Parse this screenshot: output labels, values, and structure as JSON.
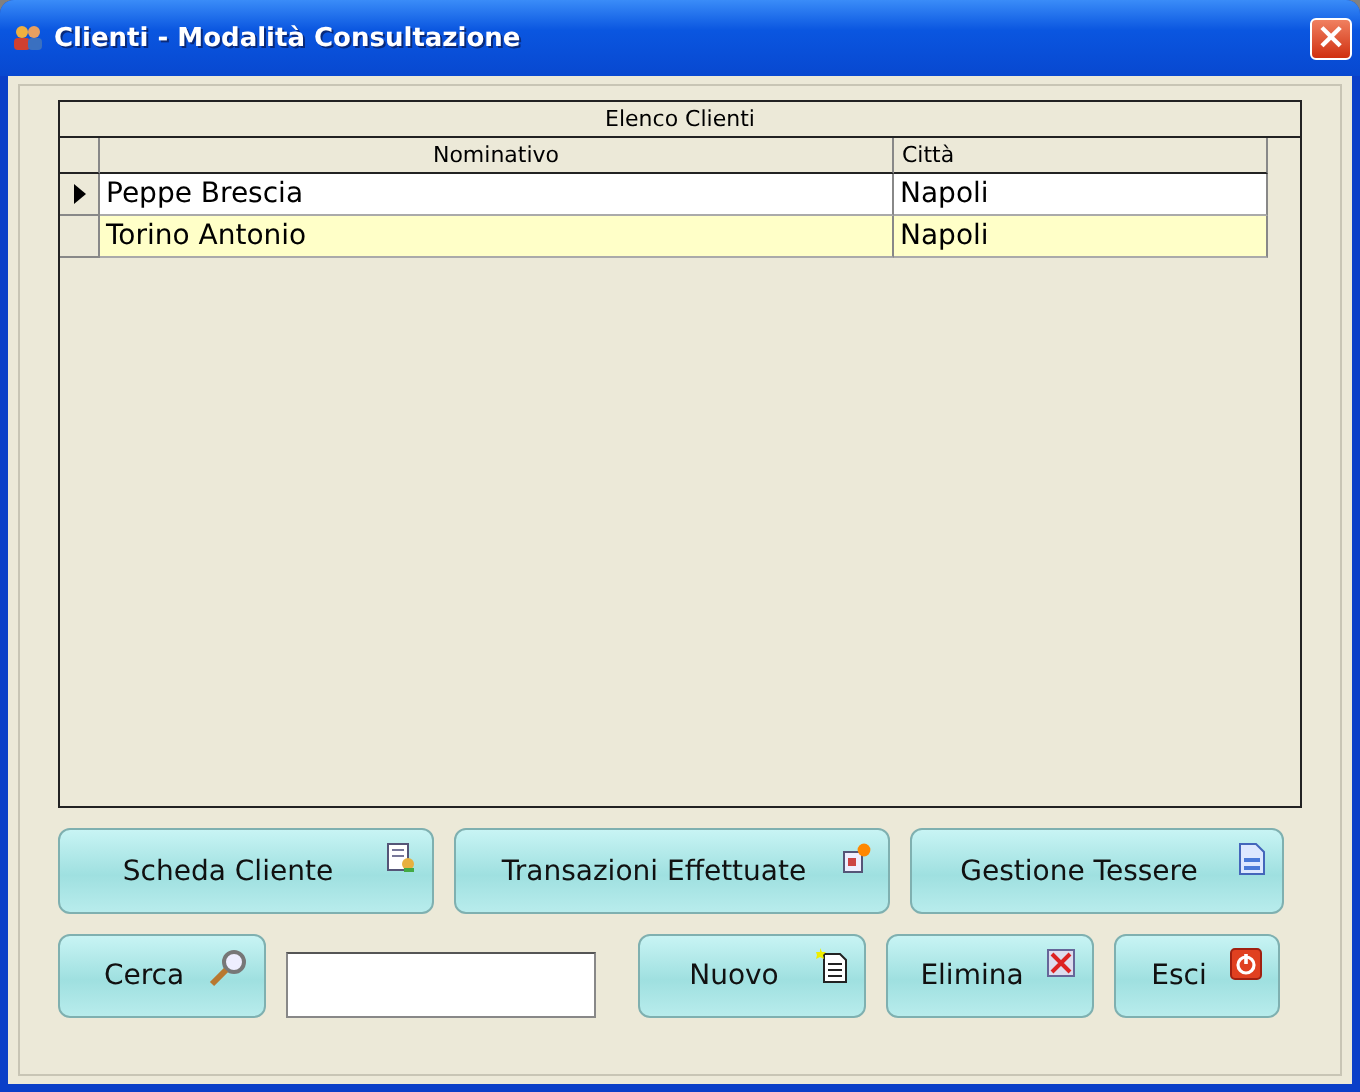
{
  "window": {
    "title": "Clienti - Modalità Consultazione",
    "close": "×"
  },
  "grid": {
    "caption": "Elenco Clienti",
    "columns": [
      "Nominativo",
      "Città"
    ],
    "rows": [
      {
        "cells": [
          "Peppe Brescia",
          "Napoli"
        ],
        "current": true
      },
      {
        "cells": [
          "Torino Antonio",
          "Napoli"
        ],
        "current": false
      }
    ]
  },
  "buttons_top": [
    {
      "label": "Scheda Cliente"
    },
    {
      "label": "Transazioni Effettuate"
    },
    {
      "label": "Gestione Tessere"
    }
  ],
  "search": {
    "label": "Cerca"
  },
  "buttons_bottom": [
    {
      "label": "Nuovo"
    },
    {
      "label": "Elimina"
    },
    {
      "label": "Esci"
    }
  ]
}
